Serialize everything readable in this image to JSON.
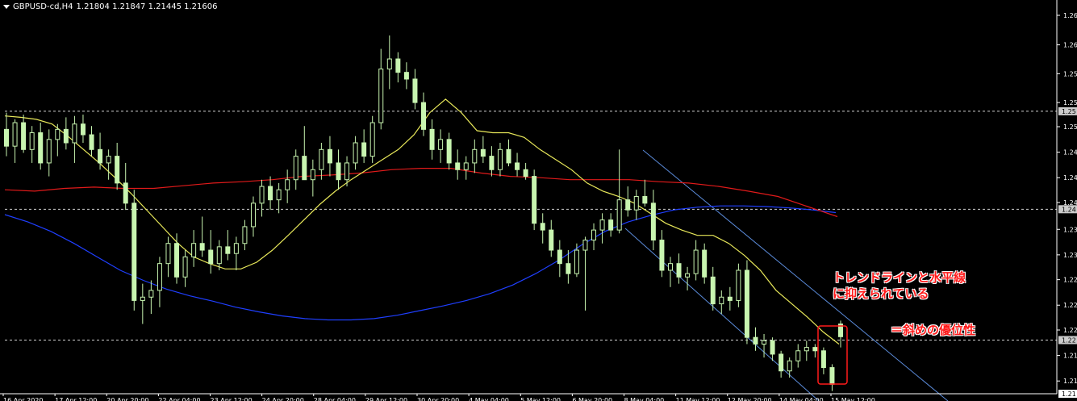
{
  "header": {
    "symbol": "GBPUSD-cd,H4",
    "ohlc": "1.21804 1.21847 1.21445 1.21606"
  },
  "annotations": {
    "line1": "トレンドラインと水平線",
    "line2": "に抑えられている",
    "line3": "＝斜めの優位性"
  },
  "colors": {
    "background": "#000000",
    "bull_candle": "#c8f5b0",
    "bear_candle": "#c8f5b0",
    "ma_fast": "#e8e85a",
    "ma_mid": "#e01a1a",
    "ma_slow": "#1f3fff",
    "trendline": "#5a8ad8",
    "annotation": "#ff1a1a"
  },
  "chart_data": {
    "type": "candlestick",
    "timeframe": "H4",
    "y_range": [
      1.2076,
      1.2646
    ],
    "y_ticks": [
      "1.26",
      "1.26",
      "1.25",
      "1.25",
      "1.25",
      "1.24",
      "1.24",
      "1.24",
      "1.23",
      "1.23",
      "1.22",
      "1.22",
      "1.22",
      "1.21",
      "1.21"
    ],
    "y_tick_values": [
      1.264,
      1.2596,
      1.2553,
      1.251,
      1.2474,
      1.2436,
      1.2398,
      1.2361,
      1.2321,
      1.2283,
      1.2246,
      1.2208,
      1.2171,
      1.2133,
      1.2095
    ],
    "horizontal_level_labels": [
      "1.25",
      "1.24",
      "1.22",
      "1.21"
    ],
    "horizontal_levels": [
      1.2497,
      1.2351,
      1.2156,
      1.2076
    ],
    "x_labels": [
      "16 Apr 2020",
      "17 Apr 12:00",
      "20 Apr 20:00",
      "22 Apr 04:00",
      "23 Apr 12:00",
      "24 Apr 20:00",
      "28 Apr 04:00",
      "29 Apr 12:00",
      "30 Apr 20:00",
      "4 May 04:00",
      "5 May 12:00",
      "6 May 20:00",
      "8 May 04:00",
      "11 May 12:00",
      "12 May 20:00",
      "14 May 04:00",
      "15 May 12:00"
    ],
    "candles": [
      {
        "o": 1.247,
        "h": 1.2495,
        "l": 1.243,
        "c": 1.2445
      },
      {
        "o": 1.2445,
        "h": 1.2485,
        "l": 1.242,
        "c": 1.248
      },
      {
        "o": 1.248,
        "h": 1.2492,
        "l": 1.2435,
        "c": 1.244
      },
      {
        "o": 1.244,
        "h": 1.2475,
        "l": 1.242,
        "c": 1.2465
      },
      {
        "o": 1.2465,
        "h": 1.248,
        "l": 1.241,
        "c": 1.242
      },
      {
        "o": 1.242,
        "h": 1.247,
        "l": 1.24,
        "c": 1.2455
      },
      {
        "o": 1.2455,
        "h": 1.2478,
        "l": 1.243,
        "c": 1.247
      },
      {
        "o": 1.247,
        "h": 1.2488,
        "l": 1.244,
        "c": 1.245
      },
      {
        "o": 1.245,
        "h": 1.249,
        "l": 1.242,
        "c": 1.2478
      },
      {
        "o": 1.2478,
        "h": 1.2492,
        "l": 1.245,
        "c": 1.2462
      },
      {
        "o": 1.2462,
        "h": 1.2475,
        "l": 1.243,
        "c": 1.244
      },
      {
        "o": 1.244,
        "h": 1.2465,
        "l": 1.241,
        "c": 1.242
      },
      {
        "o": 1.242,
        "h": 1.244,
        "l": 1.2395,
        "c": 1.243
      },
      {
        "o": 1.243,
        "h": 1.245,
        "l": 1.238,
        "c": 1.239
      },
      {
        "o": 1.239,
        "h": 1.242,
        "l": 1.235,
        "c": 1.236
      },
      {
        "o": 1.236,
        "h": 1.238,
        "l": 1.22,
        "c": 1.2215
      },
      {
        "o": 1.2215,
        "h": 1.224,
        "l": 1.218,
        "c": 1.222
      },
      {
        "o": 1.222,
        "h": 1.2245,
        "l": 1.2195,
        "c": 1.223
      },
      {
        "o": 1.223,
        "h": 1.228,
        "l": 1.2205,
        "c": 1.227
      },
      {
        "o": 1.227,
        "h": 1.231,
        "l": 1.225,
        "c": 1.23
      },
      {
        "o": 1.23,
        "h": 1.2315,
        "l": 1.224,
        "c": 1.225
      },
      {
        "o": 1.225,
        "h": 1.229,
        "l": 1.2235,
        "c": 1.228
      },
      {
        "o": 1.228,
        "h": 1.232,
        "l": 1.2265,
        "c": 1.23
      },
      {
        "o": 1.23,
        "h": 1.234,
        "l": 1.228,
        "c": 1.229
      },
      {
        "o": 1.229,
        "h": 1.232,
        "l": 1.2255,
        "c": 1.227
      },
      {
        "o": 1.227,
        "h": 1.2305,
        "l": 1.226,
        "c": 1.2295
      },
      {
        "o": 1.2295,
        "h": 1.232,
        "l": 1.2275,
        "c": 1.2285
      },
      {
        "o": 1.2285,
        "h": 1.231,
        "l": 1.226,
        "c": 1.23
      },
      {
        "o": 1.23,
        "h": 1.2335,
        "l": 1.229,
        "c": 1.2325
      },
      {
        "o": 1.2325,
        "h": 1.237,
        "l": 1.231,
        "c": 1.236
      },
      {
        "o": 1.236,
        "h": 1.2395,
        "l": 1.234,
        "c": 1.2385
      },
      {
        "o": 1.2385,
        "h": 1.24,
        "l": 1.235,
        "c": 1.2365
      },
      {
        "o": 1.2365,
        "h": 1.239,
        "l": 1.2345,
        "c": 1.238
      },
      {
        "o": 1.238,
        "h": 1.241,
        "l": 1.236,
        "c": 1.2395
      },
      {
        "o": 1.2395,
        "h": 1.244,
        "l": 1.238,
        "c": 1.243
      },
      {
        "o": 1.243,
        "h": 1.2475,
        "l": 1.241,
        "c": 1.2395
      },
      {
        "o": 1.2395,
        "h": 1.2425,
        "l": 1.237,
        "c": 1.241
      },
      {
        "o": 1.241,
        "h": 1.245,
        "l": 1.2395,
        "c": 1.244
      },
      {
        "o": 1.244,
        "h": 1.246,
        "l": 1.24,
        "c": 1.242
      },
      {
        "o": 1.242,
        "h": 1.244,
        "l": 1.238,
        "c": 1.2395
      },
      {
        "o": 1.2395,
        "h": 1.243,
        "l": 1.2385,
        "c": 1.242
      },
      {
        "o": 1.242,
        "h": 1.246,
        "l": 1.241,
        "c": 1.245
      },
      {
        "o": 1.245,
        "h": 1.247,
        "l": 1.242,
        "c": 1.243
      },
      {
        "o": 1.243,
        "h": 1.249,
        "l": 1.242,
        "c": 1.248
      },
      {
        "o": 1.248,
        "h": 1.259,
        "l": 1.247,
        "c": 1.256
      },
      {
        "o": 1.256,
        "h": 1.261,
        "l": 1.253,
        "c": 1.2575
      },
      {
        "o": 1.2575,
        "h": 1.2585,
        "l": 1.254,
        "c": 1.2555
      },
      {
        "o": 1.2555,
        "h": 1.257,
        "l": 1.253,
        "c": 1.2545
      },
      {
        "o": 1.2545,
        "h": 1.256,
        "l": 1.25,
        "c": 1.251
      },
      {
        "o": 1.251,
        "h": 1.2525,
        "l": 1.246,
        "c": 1.247
      },
      {
        "o": 1.247,
        "h": 1.2485,
        "l": 1.2425,
        "c": 1.244
      },
      {
        "o": 1.244,
        "h": 1.247,
        "l": 1.242,
        "c": 1.2455
      },
      {
        "o": 1.2455,
        "h": 1.2465,
        "l": 1.241,
        "c": 1.242
      },
      {
        "o": 1.242,
        "h": 1.244,
        "l": 1.2395,
        "c": 1.241
      },
      {
        "o": 1.241,
        "h": 1.243,
        "l": 1.2395,
        "c": 1.242
      },
      {
        "o": 1.242,
        "h": 1.2455,
        "l": 1.2405,
        "c": 1.244
      },
      {
        "o": 1.244,
        "h": 1.246,
        "l": 1.242,
        "c": 1.243
      },
      {
        "o": 1.243,
        "h": 1.2445,
        "l": 1.24,
        "c": 1.241
      },
      {
        "o": 1.241,
        "h": 1.245,
        "l": 1.24,
        "c": 1.244
      },
      {
        "o": 1.244,
        "h": 1.2455,
        "l": 1.2415,
        "c": 1.242
      },
      {
        "o": 1.242,
        "h": 1.2435,
        "l": 1.24,
        "c": 1.241
      },
      {
        "o": 1.241,
        "h": 1.242,
        "l": 1.2395,
        "c": 1.24
      },
      {
        "o": 1.24,
        "h": 1.241,
        "l": 1.232,
        "c": 1.233
      },
      {
        "o": 1.233,
        "h": 1.2345,
        "l": 1.23,
        "c": 1.232
      },
      {
        "o": 1.232,
        "h": 1.2335,
        "l": 1.228,
        "c": 1.229
      },
      {
        "o": 1.229,
        "h": 1.2305,
        "l": 1.225,
        "c": 1.227
      },
      {
        "o": 1.227,
        "h": 1.229,
        "l": 1.224,
        "c": 1.2255
      },
      {
        "o": 1.2255,
        "h": 1.23,
        "l": 1.225,
        "c": 1.229
      },
      {
        "o": 1.229,
        "h": 1.231,
        "l": 1.22,
        "c": 1.2305
      },
      {
        "o": 1.2305,
        "h": 1.233,
        "l": 1.229,
        "c": 1.232
      },
      {
        "o": 1.232,
        "h": 1.2345,
        "l": 1.23,
        "c": 1.2335
      },
      {
        "o": 1.2335,
        "h": 1.2345,
        "l": 1.231,
        "c": 1.232
      },
      {
        "o": 1.232,
        "h": 1.244,
        "l": 1.2315,
        "c": 1.2365
      },
      {
        "o": 1.2365,
        "h": 1.2385,
        "l": 1.234,
        "c": 1.235
      },
      {
        "o": 1.235,
        "h": 1.238,
        "l": 1.2335,
        "c": 1.237
      },
      {
        "o": 1.237,
        "h": 1.2395,
        "l": 1.2355,
        "c": 1.236
      },
      {
        "o": 1.236,
        "h": 1.238,
        "l": 1.229,
        "c": 1.2305
      },
      {
        "o": 1.2305,
        "h": 1.232,
        "l": 1.225,
        "c": 1.226
      },
      {
        "o": 1.226,
        "h": 1.228,
        "l": 1.2235,
        "c": 1.227
      },
      {
        "o": 1.227,
        "h": 1.2285,
        "l": 1.224,
        "c": 1.225
      },
      {
        "o": 1.225,
        "h": 1.2265,
        "l": 1.223,
        "c": 1.2255
      },
      {
        "o": 1.2255,
        "h": 1.2305,
        "l": 1.2245,
        "c": 1.229
      },
      {
        "o": 1.229,
        "h": 1.23,
        "l": 1.224,
        "c": 1.225
      },
      {
        "o": 1.225,
        "h": 1.2265,
        "l": 1.22,
        "c": 1.221
      },
      {
        "o": 1.221,
        "h": 1.223,
        "l": 1.2195,
        "c": 1.222
      },
      {
        "o": 1.222,
        "h": 1.2235,
        "l": 1.22,
        "c": 1.2215
      },
      {
        "o": 1.2215,
        "h": 1.227,
        "l": 1.2205,
        "c": 1.226
      },
      {
        "o": 1.226,
        "h": 1.2275,
        "l": 1.215,
        "c": 1.216
      },
      {
        "o": 1.216,
        "h": 1.2175,
        "l": 1.214,
        "c": 1.215
      },
      {
        "o": 1.215,
        "h": 1.2165,
        "l": 1.213,
        "c": 1.2155
      },
      {
        "o": 1.2155,
        "h": 1.216,
        "l": 1.2125,
        "c": 1.2135
      },
      {
        "o": 1.2135,
        "h": 1.214,
        "l": 1.21,
        "c": 1.211
      },
      {
        "o": 1.211,
        "h": 1.213,
        "l": 1.21,
        "c": 1.2125
      },
      {
        "o": 1.2125,
        "h": 1.215,
        "l": 1.2115,
        "c": 1.214
      },
      {
        "o": 1.214,
        "h": 1.2155,
        "l": 1.2125,
        "c": 1.2145
      },
      {
        "o": 1.2145,
        "h": 1.215,
        "l": 1.213,
        "c": 1.214
      },
      {
        "o": 1.214,
        "h": 1.2145,
        "l": 1.2105,
        "c": 1.2115
      },
      {
        "o": 1.2115,
        "h": 1.212,
        "l": 1.208,
        "c": 1.209
      },
      {
        "o": 1.218,
        "h": 1.2185,
        "l": 1.2145,
        "c": 1.2161
      }
    ],
    "ma_fast": [
      1.249,
      1.2488,
      1.2485,
      1.2478,
      1.246,
      1.244,
      1.242,
      1.2398,
      1.2375,
      1.235,
      1.2325,
      1.23,
      1.228,
      1.227,
      1.2262,
      1.2262,
      1.2272,
      1.229,
      1.2312,
      1.2335,
      1.2358,
      1.2378,
      1.2395,
      1.241,
      1.2425,
      1.244,
      1.2462,
      1.2495,
      1.2515,
      1.2495,
      1.2468,
      1.2465,
      1.2465,
      1.2458,
      1.244,
      1.2425,
      1.241,
      1.239,
      1.2378,
      1.237,
      1.236,
      1.2345,
      1.233,
      1.232,
      1.2312,
      1.2312,
      1.23,
      1.2282,
      1.226,
      1.223,
      1.221,
      1.219,
      1.2168,
      1.215
    ],
    "ma_mid": [
      1.238,
      1.2378,
      1.2382,
      1.2384,
      1.2382,
      1.2382,
      1.2386,
      1.239,
      1.2392,
      1.2395,
      1.24,
      1.2402,
      1.2405,
      1.241,
      1.2412,
      1.2412,
      1.2405,
      1.24,
      1.2398,
      1.2395,
      1.2395,
      1.2395,
      1.2392,
      1.239,
      1.2385,
      1.2378,
      1.237,
      1.2355,
      1.234
    ],
    "ma_slow": [
      1.2343,
      1.2332,
      1.2318,
      1.23,
      1.228,
      1.226,
      1.2245,
      1.2232,
      1.2222,
      1.2214,
      1.2205,
      1.2198,
      1.2192,
      1.2188,
      1.2186,
      1.2186,
      1.2188,
      1.2193,
      1.22,
      1.2207,
      1.2215,
      1.2225,
      1.2238,
      1.2255,
      1.2275,
      1.2298,
      1.2318,
      1.2332,
      1.2342,
      1.235,
      1.2354,
      1.2356,
      1.2356,
      1.2355,
      1.2353,
      1.235,
      1.2346
    ]
  }
}
